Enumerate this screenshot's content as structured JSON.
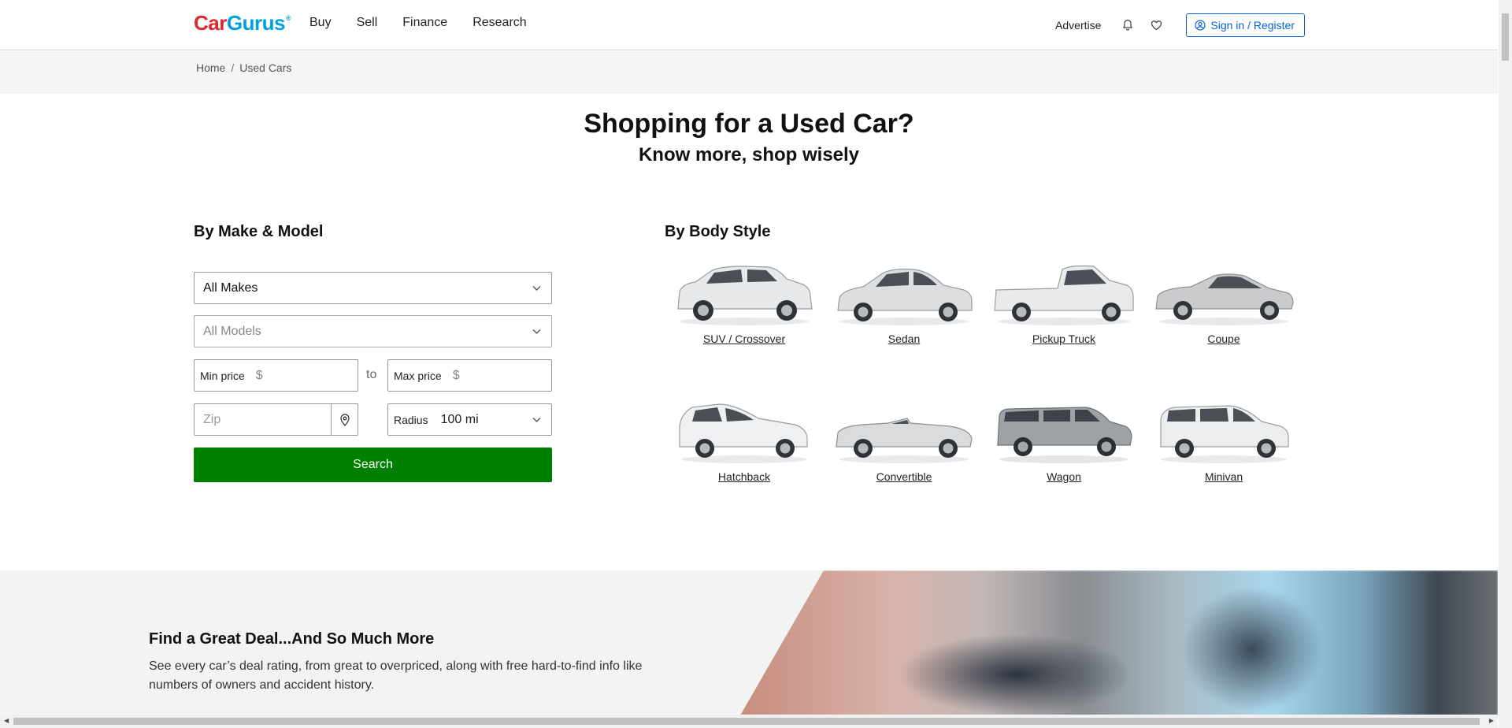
{
  "header": {
    "logo": {
      "car": "Car",
      "gurus": "Gurus",
      "tm": "®"
    },
    "nav": [
      "Buy",
      "Sell",
      "Finance",
      "Research"
    ],
    "advertise": "Advertise",
    "icons": [
      "bell-icon",
      "heart-icon"
    ],
    "signin_label": "Sign in / Register"
  },
  "breadcrumb": {
    "items": [
      "Home",
      "Used Cars"
    ],
    "separator": "/"
  },
  "hero": {
    "title": "Shopping for a Used Car?",
    "subtitle": "Know more, shop wisely"
  },
  "make_model": {
    "title": "By Make & Model",
    "makes_value": "All Makes",
    "models_value": "All Models",
    "min_price_label": "Min price",
    "max_price_label": "Max price",
    "currency": "$",
    "to_label": "to",
    "zip_placeholder": "Zip",
    "radius_label": "Radius",
    "radius_value": "100 mi",
    "search_label": "Search"
  },
  "body_style": {
    "title": "By Body Style",
    "items": [
      {
        "label": "SUV / Crossover",
        "color": "#e6e8ea"
      },
      {
        "label": "Sedan",
        "color": "#dcdee0"
      },
      {
        "label": "Pickup Truck",
        "color": "#e8eaec"
      },
      {
        "label": "Coupe",
        "color": "#c9cbcd"
      },
      {
        "label": "Hatchback",
        "color": "#eef0f2"
      },
      {
        "label": "Convertible",
        "color": "#d9dbdd"
      },
      {
        "label": "Wagon",
        "color": "#9ea2a6"
      },
      {
        "label": "Minivan",
        "color": "#eceeee"
      }
    ]
  },
  "promo": {
    "title": "Find a Great Deal...And So Much More",
    "text": "See every car’s deal rating, from great to overpriced, along with free hard-to-find info like numbers of owners and accident history."
  },
  "colors": {
    "accent_blue": "#0763d3",
    "search_green": "#008000",
    "logo_red": "#e0262f",
    "logo_blue": "#00a0dd"
  }
}
